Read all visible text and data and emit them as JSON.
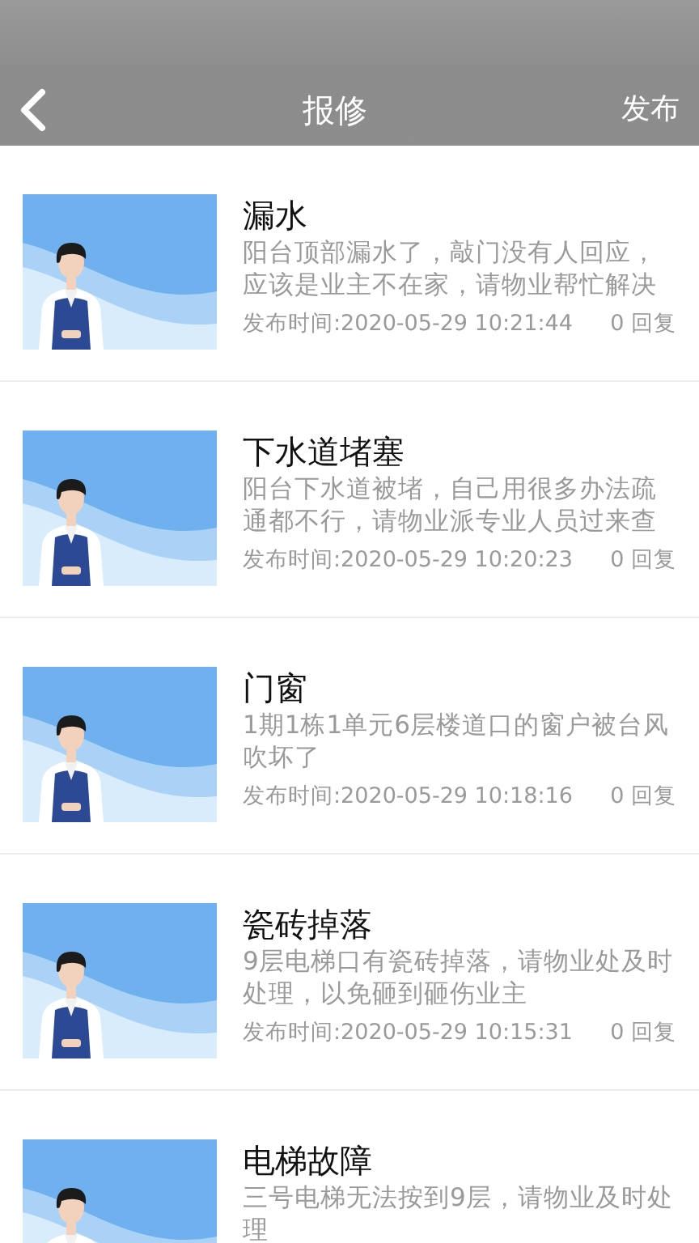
{
  "header": {
    "title": "报修",
    "action": "发布"
  },
  "posts": [
    {
      "title": "漏水",
      "description": "阳台顶部漏水了，敲门没有人回应，应该是业主不在家，请物业帮忙解决",
      "time": "发布时间:2020-05-29 10:21:44",
      "replies": "0 回复"
    },
    {
      "title": "下水道堵塞",
      "description": "阳台下水道被堵，自己用很多办法疏通都不行，请物业派专业人员过来查",
      "time": "发布时间:2020-05-29 10:20:23",
      "replies": "0 回复"
    },
    {
      "title": "门窗",
      "description": "1期1栋1单元6层楼道口的窗户被台风吹坏了",
      "time": "发布时间:2020-05-29 10:18:16",
      "replies": "0 回复"
    },
    {
      "title": "瓷砖掉落",
      "description": "9层电梯口有瓷砖掉落，请物业处及时处理，以免砸到砸伤业主",
      "time": "发布时间:2020-05-29 10:15:31",
      "replies": "0 回复"
    },
    {
      "title": "电梯故障",
      "description": "三号电梯无法按到9层，请物业及时处理"
    }
  ]
}
